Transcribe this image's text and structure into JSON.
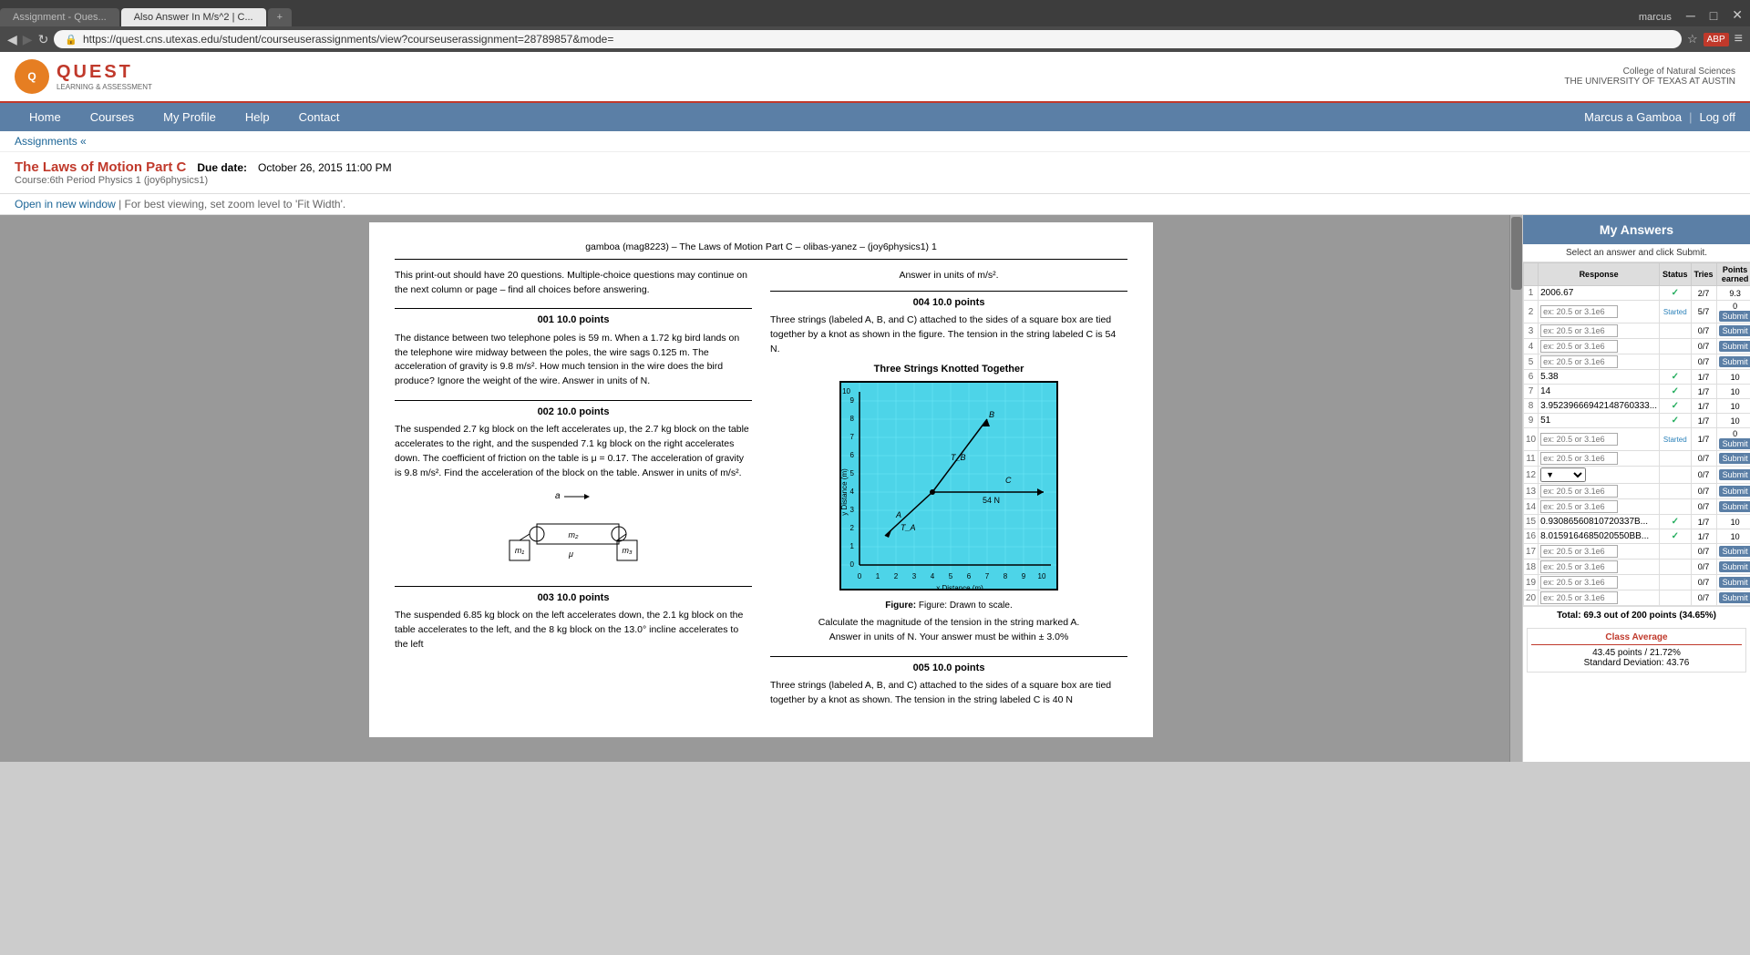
{
  "browser": {
    "tabs": [
      {
        "label": "Assignment - Ques...",
        "active": false
      },
      {
        "label": "Also Answer In M/s^2 | C...",
        "active": true
      },
      {
        "label": "",
        "active": false
      }
    ],
    "url": "https://quest.cns.utexas.edu/student/courseuserassignments/view?courseuserassignment=28789857&mode=",
    "user": "marcus"
  },
  "header": {
    "logo_text": "QUEST",
    "logo_subtitle": "LEARNING &\nASSESSMENT",
    "cns_text": "College of Natural Sciences\nTHE UNIVERSITY OF TEXAS AT AUSTIN"
  },
  "nav": {
    "links": [
      "Home",
      "Courses",
      "My Profile",
      "Help",
      "Contact"
    ],
    "user_name": "Marcus a Gamboa",
    "log_off": "Log off"
  },
  "breadcrumb": {
    "text": "Assignments «"
  },
  "assignment": {
    "title": "The Laws of Motion Part C",
    "due_label": "Due date:",
    "due_date": "October 26, 2015 11:00 PM",
    "course": "Course:6th Period Physics 1 (joy6physics1)",
    "open_new_window": "Open in new window",
    "zoom_hint": "| For best viewing, set zoom level to 'Fit Width'."
  },
  "document": {
    "header": "gamboa (mag8223) – The Laws of Motion Part C – olibas-yanez – (joy6physics1)     1",
    "intro": "This print-out should have 20 questions. Multiple-choice questions may continue on the next column or page – find all choices before answering.",
    "q1": {
      "header": "001   10.0 points",
      "text": "The distance between two telephone poles is 59 m.  When a 1.72 kg bird lands on the telephone wire midway between the poles, the wire sags 0.125 m.\n    The acceleration of gravity is 9.8 m/s².\n    How much tension in the wire does the bird produce?  Ignore the weight of the wire.\n    Answer in units of N."
    },
    "q2": {
      "header": "002   10.0 points",
      "text": "The suspended 2.7 kg block on the left accelerates up, the 2.7 kg block on the table accelerates to the right, and the suspended 7.1 kg block on the right accelerates down.  The coefficient of friction on the table is μ = 0.17.\n    The acceleration of gravity is 9.8 m/s².\n    Find the acceleration of the block on the table.\n    Answer in units of m/s²."
    },
    "q3": {
      "header": "003   10.0 points",
      "text": "The suspended 6.85 kg block on the left accelerates down, the 2.1 kg block on the table accelerates to the left, and the 8 kg block on the 13.0° incline accelerates to the left"
    },
    "q4": {
      "header": "004   10.0 points",
      "answer_units": "Answer in units of  m/s².",
      "text": "Three strings (labeled A, B, and C) attached to the sides of a square box are tied together by a knot as shown in the figure. The tension in the string labeled C is 54 N.",
      "graph_title": "Three Strings Knotted Together",
      "figure_caption": "Figure:  Drawn to scale.",
      "figure_question": "Calculate the magnitude of the tension in the string marked A.",
      "answer_units2": "Answer in units of N.  Your answer must be within ± 3.0%"
    },
    "q5": {
      "header": "005   10.0 points",
      "text": "Three strings (labeled A, B, and C) attached to the sides of a square box are tied together by a knot as shown.  The tension in the string labeled C is 40 N"
    }
  },
  "my_answers": {
    "panel_title": "My Answers",
    "instruction": "Select an answer and click Submit.",
    "col_response": "Response",
    "col_status": "Status",
    "col_tries": "Tries",
    "col_points": "Points earned",
    "rows": [
      {
        "num": 1,
        "response": "2006.67",
        "status": "check",
        "tries": "2/7",
        "points": "9.3"
      },
      {
        "num": 2,
        "response": "",
        "placeholder": "ex: 20.5 or 3.1e6",
        "status": "started",
        "tries": "5/7",
        "points": "0",
        "has_submit": true
      },
      {
        "num": 3,
        "response": "",
        "placeholder": "ex: 20.5 or 3.1e6",
        "status": "",
        "tries": "0/7",
        "points": "",
        "has_submit": true
      },
      {
        "num": 4,
        "response": "",
        "placeholder": "ex: 20.5 or 3.1e6",
        "status": "",
        "tries": "0/7",
        "points": "",
        "has_submit": true
      },
      {
        "num": 5,
        "response": "",
        "placeholder": "ex: 20.5 or 3.1e6",
        "status": "",
        "tries": "0/7",
        "points": "",
        "has_submit": true
      },
      {
        "num": 6,
        "response": "5.38",
        "status": "check",
        "tries": "1/7",
        "points": "10"
      },
      {
        "num": 7,
        "response": "14",
        "status": "check",
        "tries": "1/7",
        "points": "10"
      },
      {
        "num": 8,
        "response": "3.95239666942148760333...",
        "status": "check",
        "tries": "1/7",
        "points": "10"
      },
      {
        "num": 9,
        "response": "51",
        "status": "check",
        "tries": "1/7",
        "points": "10"
      },
      {
        "num": 10,
        "response": "",
        "placeholder": "ex: 20.5 or 3.1e6",
        "status": "started",
        "tries": "1/7",
        "points": "0",
        "has_submit": true
      },
      {
        "num": 11,
        "response": "",
        "placeholder": "ex: 20.5 or 3.1e6",
        "status": "",
        "tries": "0/7",
        "points": "",
        "has_submit": true
      },
      {
        "num": 12,
        "response": "",
        "is_dropdown": true,
        "status": "",
        "tries": "0/7",
        "points": "",
        "has_submit": true
      },
      {
        "num": 13,
        "response": "",
        "placeholder": "ex: 20.5 or 3.1e6",
        "status": "",
        "tries": "0/7",
        "points": "",
        "has_submit": true
      },
      {
        "num": 14,
        "response": "",
        "placeholder": "ex: 20.5 or 3.1e6",
        "status": "",
        "tries": "0/7",
        "points": "",
        "has_submit": true
      },
      {
        "num": 15,
        "response": "0.93086560810720337B...",
        "status": "check",
        "tries": "1/7",
        "points": "10"
      },
      {
        "num": 16,
        "response": "8.0159164685020550BB...",
        "status": "check",
        "tries": "1/7",
        "points": "10"
      },
      {
        "num": 17,
        "response": "",
        "placeholder": "ex: 20.5 or 3.1e6",
        "status": "",
        "tries": "0/7",
        "points": "",
        "has_submit": true
      },
      {
        "num": 18,
        "response": "",
        "placeholder": "ex: 20.5 or 3.1e6",
        "status": "",
        "tries": "0/7",
        "points": "",
        "has_submit": true
      },
      {
        "num": 19,
        "response": "",
        "placeholder": "ex: 20.5 or 3.1e6",
        "status": "",
        "tries": "0/7",
        "points": "",
        "has_submit": true
      },
      {
        "num": 20,
        "response": "",
        "placeholder": "ex: 20.5 or 3.1e6",
        "status": "",
        "tries": "0/7",
        "points": "",
        "has_submit": true
      }
    ],
    "total": "Total: 69.3 out of 200 points (34.65%)",
    "class_avg_header": "Class Average",
    "class_avg_points": "43.45 points / 21.72%",
    "class_avg_std": "Standard Deviation: 43.76"
  },
  "colors": {
    "nav_bg": "#5b7fa6",
    "header_border": "#c0392b",
    "title_color": "#c0392b",
    "link_color": "#1a6496",
    "check_color": "#27ae60"
  }
}
